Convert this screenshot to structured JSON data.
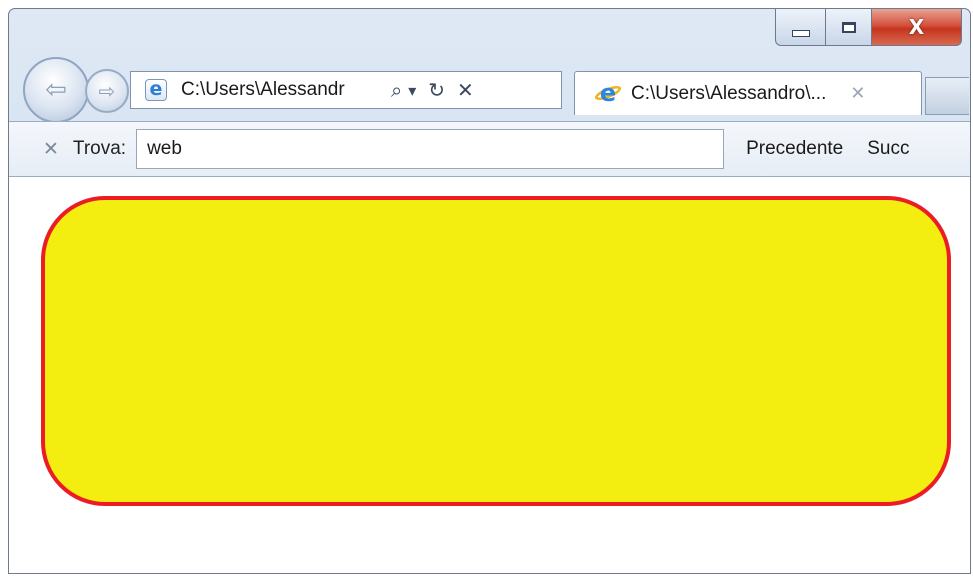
{
  "window": {
    "caption_buttons": {
      "minimize_icon": "minimize-icon",
      "maximize_icon": "maximize-icon",
      "close_label": "X"
    }
  },
  "navigation": {
    "back_icon": "back-arrow-icon",
    "forward_icon": "forward-arrow-icon",
    "address": "C:\\Users\\Alessandr",
    "search_glyph": "⌕",
    "dropdown_glyph": "▾",
    "refresh_glyph": "↻",
    "stop_glyph": "✕"
  },
  "tab": {
    "title": "C:\\Users\\Alessandro\\...",
    "close_glyph": "✕"
  },
  "find_bar": {
    "close_glyph": "✕",
    "label": "Trova:",
    "value": "web",
    "previous_label": "Precedente",
    "next_label": "Succ"
  },
  "content": {
    "box_fill": "#f4ed10",
    "box_border": "#ec1c24"
  }
}
